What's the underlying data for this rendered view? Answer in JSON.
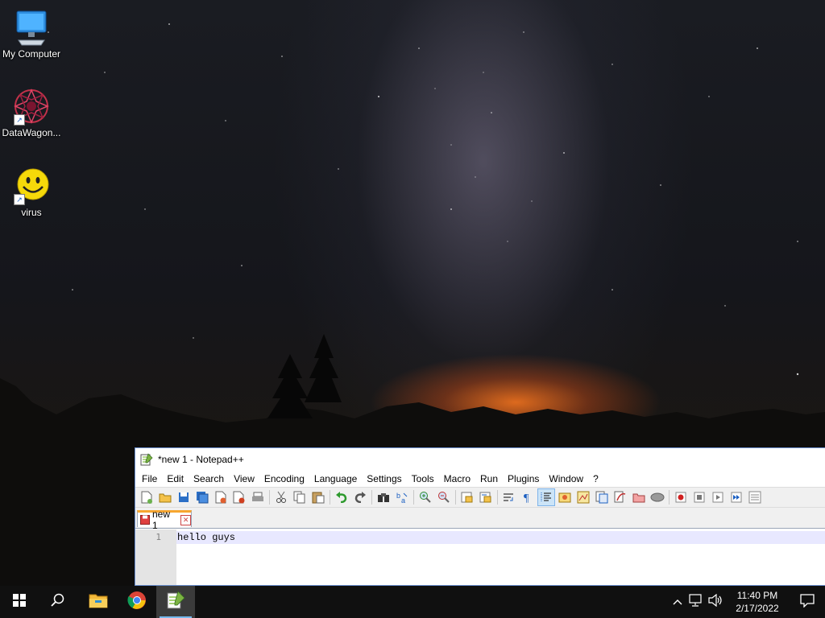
{
  "desktop": {
    "icons": [
      {
        "label": "My Computer",
        "icon": "monitor-icon"
      },
      {
        "label": "DataWagon...",
        "icon": "datawagon-icon"
      },
      {
        "label": "virus",
        "icon": "smiley-icon"
      }
    ]
  },
  "window": {
    "title": "*new 1 - Notepad++",
    "menu": [
      "File",
      "Edit",
      "Search",
      "View",
      "Encoding",
      "Language",
      "Settings",
      "Tools",
      "Macro",
      "Run",
      "Plugins",
      "Window",
      "?"
    ],
    "tab": {
      "label": "new 1"
    },
    "editor": {
      "line_number": "1",
      "content": "hello guys"
    }
  },
  "taskbar": {
    "apps": [
      "start-icon",
      "search-icon",
      "file-explorer-icon",
      "chrome-icon",
      "notepad-plus-plus-icon"
    ],
    "tray": {
      "time": "11:40 PM",
      "date": "2/17/2022"
    }
  },
  "colors": {
    "taskbar": "#101010",
    "window_border": "#6a8fcf",
    "tab_accent": "#f7a630",
    "current_line": "#e8e8ff"
  }
}
